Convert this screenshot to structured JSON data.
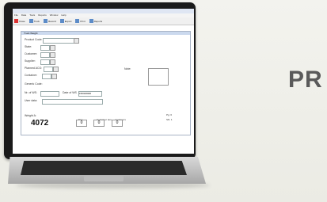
{
  "hero": {
    "headline": "PR"
  },
  "app": {
    "menu": [
      "File",
      "Data",
      "Tools",
      "Reports",
      "Window",
      "Help"
    ],
    "toolbar": [
      {
        "label": "Close"
      },
      {
        "label": "Truck"
      },
      {
        "label": "Record"
      },
      {
        "label": "Export"
      },
      {
        "label": "Print"
      },
      {
        "label": "Reports"
      }
    ],
    "form": {
      "title": "Truck Weight",
      "fields": {
        "product_code": "Product Code:",
        "state": "State:",
        "customer": "Customer:",
        "supplier": "Supplier:",
        "planned_aco": "Planned ACO:",
        "container": "Container:",
        "generic_code": "Generic Code:",
        "nr_of_ws": "Nr. of WS:",
        "user_data": "User data:",
        "weight_a": "Weight A:",
        "date_of_ws": "Date of WS",
        "notes": "Note:",
        "tare": "Tare",
        "container_tare_label": "Container tare",
        "containers": "containers"
      },
      "date_value": "15/03/2020",
      "weight_value": "4072",
      "tare_value": "0",
      "ctare_value": "0",
      "containers_value": "0",
      "right_labels": [
        "Pg: 6",
        "SN: 1"
      ]
    }
  }
}
